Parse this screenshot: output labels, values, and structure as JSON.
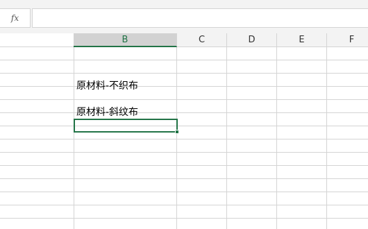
{
  "formula_bar": {
    "fx_label": "fx",
    "value": ""
  },
  "columns": [
    {
      "label": "B",
      "selected": true
    },
    {
      "label": "C",
      "selected": false
    },
    {
      "label": "D",
      "selected": false
    },
    {
      "label": "E",
      "selected": false
    },
    {
      "label": "F",
      "selected": false
    }
  ],
  "cells": [
    {
      "column": "B",
      "text": "原材料-不织布"
    },
    {
      "column": "B",
      "text": "原材料-斜纹布"
    }
  ],
  "colors": {
    "accent": "#217346",
    "gridline": "#d4d4d4",
    "header_bg": "#f3f3f3",
    "selected_header_bg": "#d2d2d2"
  }
}
